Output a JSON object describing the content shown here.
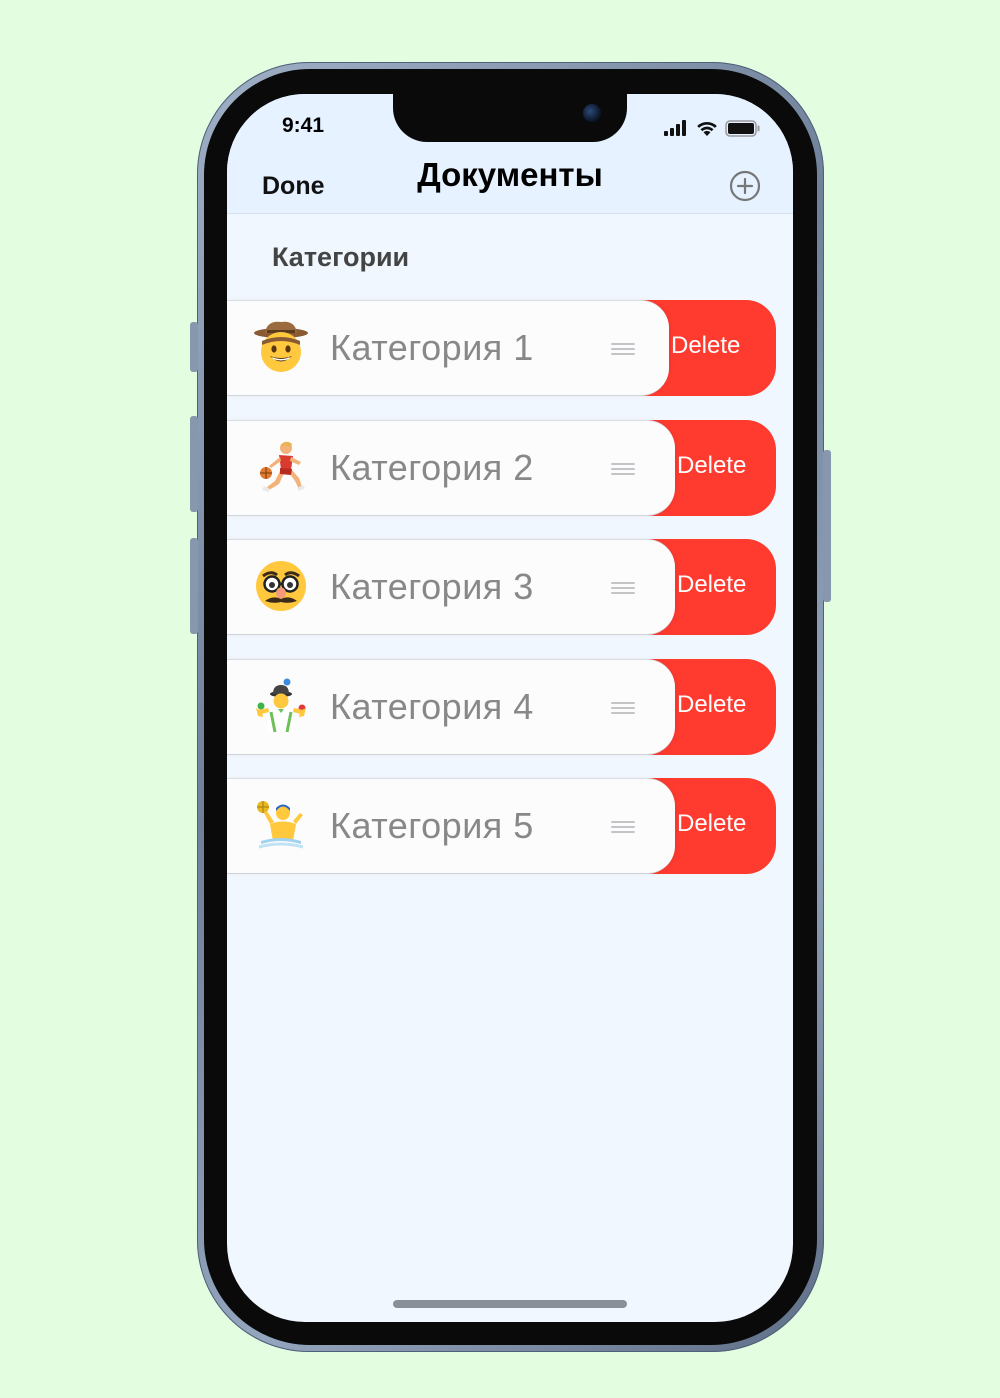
{
  "status_bar": {
    "time": "9:41",
    "icons": [
      "signal-icon",
      "wifi-icon",
      "battery-icon"
    ]
  },
  "nav": {
    "done_label": "Done",
    "title": "Документы",
    "add_icon": "plus-circle-icon"
  },
  "section": {
    "header": "Категории"
  },
  "rows": [
    {
      "emoji": "cowboy-face-icon",
      "label": "Категория 1",
      "delete_label": "Delete"
    },
    {
      "emoji": "basketball-player-icon",
      "label": "Категория 2",
      "delete_label": "Delete"
    },
    {
      "emoji": "disguised-face-icon",
      "label": "Категория 3",
      "delete_label": "Delete"
    },
    {
      "emoji": "juggler-icon",
      "label": "Категория 4",
      "delete_label": "Delete"
    },
    {
      "emoji": "water-polo-icon",
      "label": "Категория 5",
      "delete_label": "Delete"
    }
  ],
  "colors": {
    "background": "#e2fde0",
    "screen": "#f1f7fe",
    "nav": "#e6f2ff",
    "delete": "#ff3b30"
  }
}
